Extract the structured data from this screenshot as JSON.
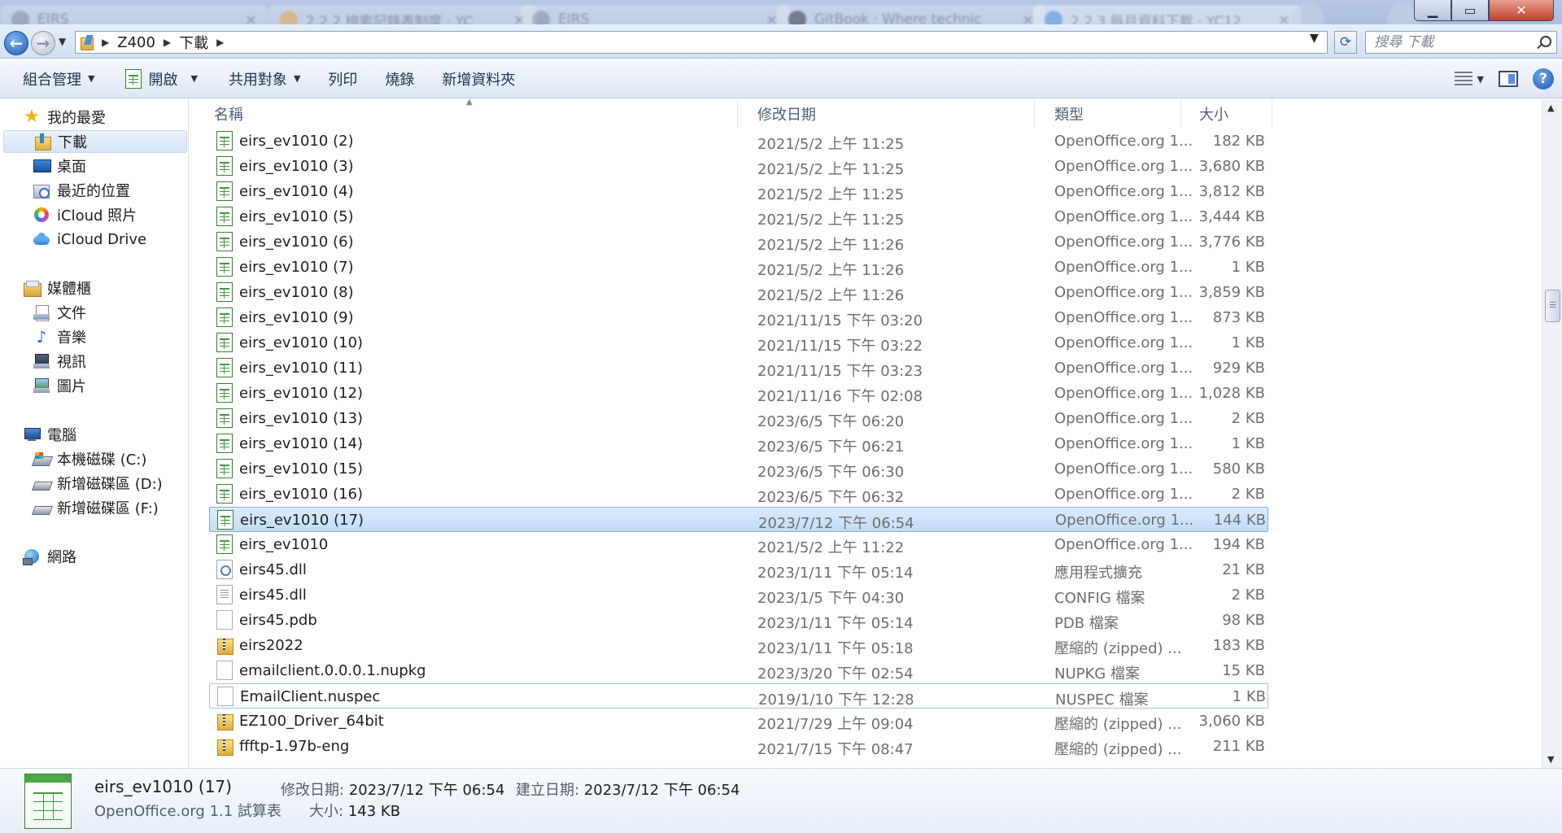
{
  "browser_tabs": [
    {
      "label": "EIRS"
    },
    {
      "label": "2.2.2 檢索記錄表制度 · YC"
    },
    {
      "label": "EIRS"
    },
    {
      "label": "GitBook · Where technic"
    },
    {
      "label": "2.2.3 每月資料下載 · YC12"
    }
  ],
  "window_controls": {
    "minimize": "▁",
    "maximize": "▭",
    "close": "✕"
  },
  "address": {
    "crumbs": [
      "Z400",
      "下載"
    ],
    "search_placeholder": "搜尋 下載"
  },
  "toolbar": {
    "organize": "組合管理",
    "open": "開啟",
    "share": "共用對象",
    "print": "列印",
    "burn": "燒錄",
    "new_folder": "新增資料夾"
  },
  "nav": {
    "favorites": "我的最愛",
    "downloads": "下載",
    "desktop": "桌面",
    "recent": "最近的位置",
    "icloud_photos": "iCloud 照片",
    "icloud_drive": "iCloud Drive",
    "libraries": "媒體櫃",
    "documents": "文件",
    "music": "音樂",
    "videos": "視訊",
    "pictures": "圖片",
    "computer": "電腦",
    "drive_c": "本機磁碟 (C:)",
    "drive_d": "新增磁碟區 (D:)",
    "drive_f": "新增磁碟區 (F:)",
    "network": "網路"
  },
  "columns": {
    "name": "名稱",
    "date": "修改日期",
    "type": "類型",
    "size": "大小"
  },
  "files": [
    {
      "name": "eirs_ev1010 (2)",
      "date": "2021/5/2 上午 11:25",
      "type": "OpenOffice.org 1...",
      "size": "182 KB",
      "icon": "calc"
    },
    {
      "name": "eirs_ev1010 (3)",
      "date": "2021/5/2 上午 11:25",
      "type": "OpenOffice.org 1...",
      "size": "3,680 KB",
      "icon": "calc"
    },
    {
      "name": "eirs_ev1010 (4)",
      "date": "2021/5/2 上午 11:25",
      "type": "OpenOffice.org 1...",
      "size": "3,812 KB",
      "icon": "calc"
    },
    {
      "name": "eirs_ev1010 (5)",
      "date": "2021/5/2 上午 11:25",
      "type": "OpenOffice.org 1...",
      "size": "3,444 KB",
      "icon": "calc"
    },
    {
      "name": "eirs_ev1010 (6)",
      "date": "2021/5/2 上午 11:26",
      "type": "OpenOffice.org 1...",
      "size": "3,776 KB",
      "icon": "calc"
    },
    {
      "name": "eirs_ev1010 (7)",
      "date": "2021/5/2 上午 11:26",
      "type": "OpenOffice.org 1...",
      "size": "1 KB",
      "icon": "calc"
    },
    {
      "name": "eirs_ev1010 (8)",
      "date": "2021/5/2 上午 11:26",
      "type": "OpenOffice.org 1...",
      "size": "3,859 KB",
      "icon": "calc"
    },
    {
      "name": "eirs_ev1010 (9)",
      "date": "2021/11/15 下午 03:20",
      "type": "OpenOffice.org 1...",
      "size": "873 KB",
      "icon": "calc"
    },
    {
      "name": "eirs_ev1010 (10)",
      "date": "2021/11/15 下午 03:22",
      "type": "OpenOffice.org 1...",
      "size": "1 KB",
      "icon": "calc"
    },
    {
      "name": "eirs_ev1010 (11)",
      "date": "2021/11/15 下午 03:23",
      "type": "OpenOffice.org 1...",
      "size": "929 KB",
      "icon": "calc"
    },
    {
      "name": "eirs_ev1010 (12)",
      "date": "2021/11/16 下午 02:08",
      "type": "OpenOffice.org 1...",
      "size": "1,028 KB",
      "icon": "calc"
    },
    {
      "name": "eirs_ev1010 (13)",
      "date": "2023/6/5 下午 06:20",
      "type": "OpenOffice.org 1...",
      "size": "2 KB",
      "icon": "calc"
    },
    {
      "name": "eirs_ev1010 (14)",
      "date": "2023/6/5 下午 06:21",
      "type": "OpenOffice.org 1...",
      "size": "1 KB",
      "icon": "calc"
    },
    {
      "name": "eirs_ev1010 (15)",
      "date": "2023/6/5 下午 06:30",
      "type": "OpenOffice.org 1...",
      "size": "580 KB",
      "icon": "calc"
    },
    {
      "name": "eirs_ev1010 (16)",
      "date": "2023/6/5 下午 06:32",
      "type": "OpenOffice.org 1...",
      "size": "2 KB",
      "icon": "calc"
    },
    {
      "name": "eirs_ev1010 (17)",
      "date": "2023/7/12 下午 06:54",
      "type": "OpenOffice.org 1...",
      "size": "144 KB",
      "icon": "calc",
      "selected": true
    },
    {
      "name": "eirs_ev1010",
      "date": "2021/5/2 上午 11:22",
      "type": "OpenOffice.org 1...",
      "size": "194 KB",
      "icon": "calc"
    },
    {
      "name": "eirs45.dll",
      "date": "2023/1/11 下午 05:14",
      "type": "應用程式擴充",
      "size": "21 KB",
      "icon": "dll"
    },
    {
      "name": "eirs45.dll",
      "date": "2023/1/5 下午 04:30",
      "type": "CONFIG 檔案",
      "size": "2 KB",
      "icon": "config"
    },
    {
      "name": "eirs45.pdb",
      "date": "2023/1/11 下午 05:14",
      "type": "PDB 檔案",
      "size": "98 KB",
      "icon": "blank"
    },
    {
      "name": "eirs2022",
      "date": "2023/1/11 下午 05:18",
      "type": "壓縮的 (zipped) ...",
      "size": "183 KB",
      "icon": "zip"
    },
    {
      "name": "emailclient.0.0.0.1.nupkg",
      "date": "2023/3/20 下午 02:54",
      "type": "NUPKG 檔案",
      "size": "15 KB",
      "icon": "blank"
    },
    {
      "name": "EmailClient.nuspec",
      "date": "2019/1/10 下午 12:28",
      "type": "NUSPEC 檔案",
      "size": "1 KB",
      "icon": "blank",
      "focused": true
    },
    {
      "name": "EZ100_Driver_64bit",
      "date": "2021/7/29 上午 09:04",
      "type": "壓縮的 (zipped) ...",
      "size": "3,060 KB",
      "icon": "zip"
    },
    {
      "name": "ffftp-1.97b-eng",
      "date": "2021/7/15 下午 08:47",
      "type": "壓縮的 (zipped) ...",
      "size": "211 KB",
      "icon": "zip"
    }
  ],
  "details": {
    "name": "eirs_ev1010 (17)",
    "type": "OpenOffice.org 1.1 試算表",
    "modified_label": "修改日期:",
    "modified_value": "2023/7/12 下午 06:54",
    "created_label": "建立日期:",
    "created_value": "2023/7/12 下午 06:54",
    "size_label": "大小:",
    "size_value": "143 KB"
  }
}
